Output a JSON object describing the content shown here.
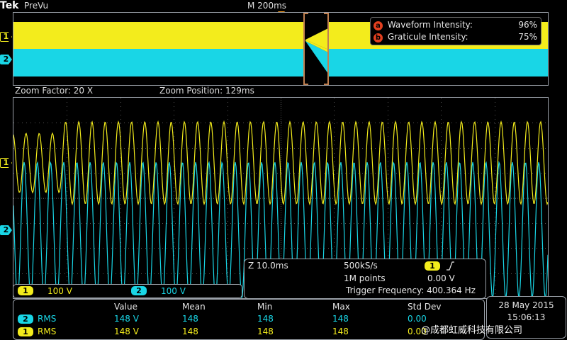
{
  "header": {
    "brand": "Tek",
    "mode": "PreVu",
    "timebase": "M 200ms"
  },
  "overview": {
    "info": [
      {
        "badge": "a",
        "label": "Waveform Intensity:",
        "value": "96%"
      },
      {
        "badge": "b",
        "label": "Graticule Intensity:",
        "value": "75%"
      }
    ],
    "ch1_marker": "1",
    "ch2_marker": "2"
  },
  "zoom": {
    "factor": "Zoom Factor: 20 X",
    "position": "Zoom Position: 129ms",
    "ch1_marker": "1",
    "ch2_marker": "2"
  },
  "channels": [
    {
      "num": "1",
      "scale": "100 V",
      "color": "#f3ec1c"
    },
    {
      "num": "2",
      "scale": "100 V",
      "color": "#19d6e6"
    }
  ],
  "acquisition": {
    "zoom_time": "Z 10.0ms",
    "sample_rate": "500kS/s",
    "trigger_channel": "1",
    "trigger_slope_icon": "rising-edge-icon",
    "points": "1M points",
    "trigger_level": "0.00 V",
    "trigger_frequency": "Trigger Frequency: 400.364 Hz"
  },
  "measurements": {
    "headers": [
      "Value",
      "Mean",
      "Min",
      "Max",
      "Std Dev"
    ],
    "rows": [
      {
        "channel": "2",
        "type": "RMS",
        "value": "148 V",
        "mean": "148",
        "min": "148",
        "max": "148",
        "std": "0.00"
      },
      {
        "channel": "1",
        "type": "RMS",
        "value": "148 V",
        "mean": "148",
        "min": "148",
        "max": "148",
        "std": "0.00"
      }
    ]
  },
  "datetime": {
    "date": "28 May  2015",
    "time": "15:06:13"
  },
  "watermark": "@成都虹威科技有限公司",
  "colors": {
    "ch1": "#f3ec1c",
    "ch2": "#19d6e6",
    "trigger": "#f39a1d",
    "badge": "#e4401f"
  }
}
